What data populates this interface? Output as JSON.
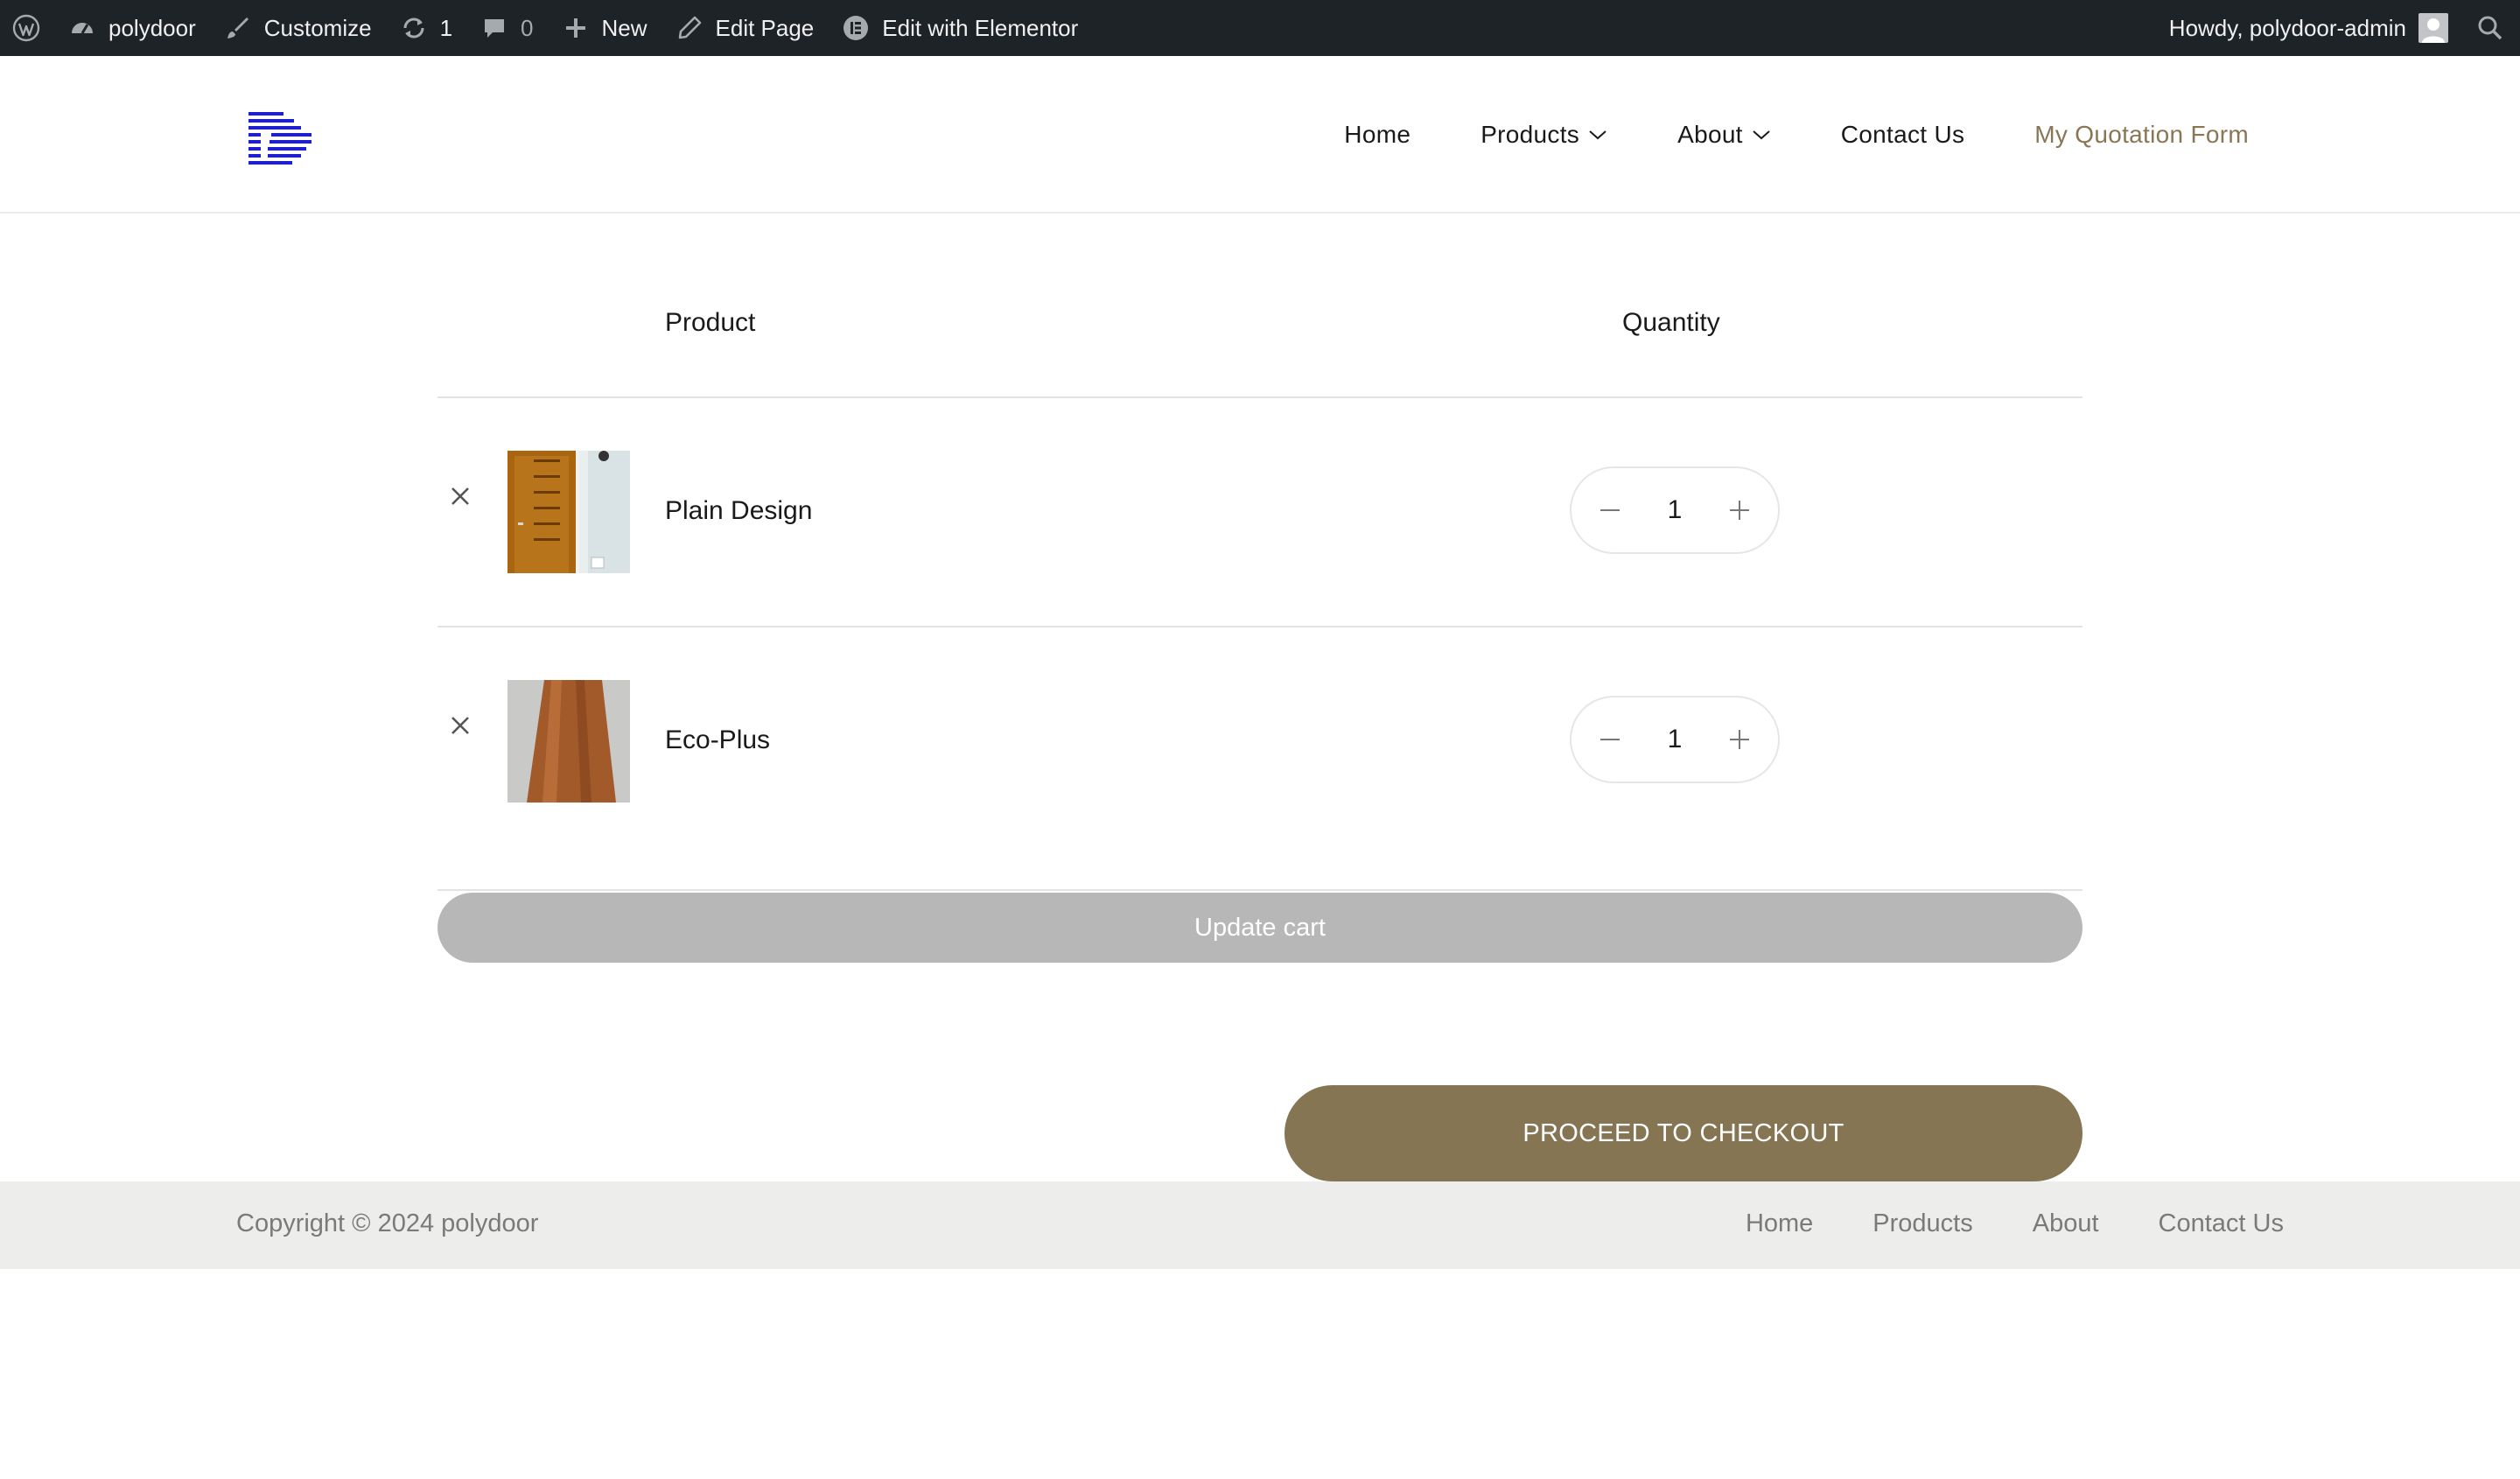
{
  "admin_bar": {
    "site_name": "polydoor",
    "customize": "Customize",
    "updates_count": "1",
    "comments_count": "0",
    "new": "New",
    "edit_page": "Edit Page",
    "edit_elementor": "Edit with Elementor",
    "howdy": "Howdy, polydoor-admin",
    "icons": [
      "wordpress-icon",
      "dashboard-icon",
      "brush-icon",
      "refresh-icon",
      "comment-icon",
      "plus-icon",
      "pencil-icon",
      "elementor-icon",
      "avatar",
      "search-icon"
    ]
  },
  "header": {
    "nav": {
      "home": "Home",
      "products": "Products",
      "about": "About",
      "contact": "Contact Us",
      "quotation": "My Quotation Form"
    },
    "accent_color": "#8a7655",
    "logo_color": "#1f1fd0"
  },
  "cart": {
    "columns": {
      "product": "Product",
      "quantity": "Quantity"
    },
    "items": [
      {
        "name": "Plain Design",
        "quantity": "1"
      },
      {
        "name": "Eco-Plus",
        "quantity": "1"
      }
    ],
    "update_label": "Update cart",
    "checkout_label": "PROCEED TO CHECKOUT",
    "checkout_color": "#857553"
  },
  "footer": {
    "copyright": "Copyright © 2024 polydoor",
    "links": {
      "home": "Home",
      "products": "Products",
      "about": "About",
      "contact": "Contact Us"
    }
  }
}
